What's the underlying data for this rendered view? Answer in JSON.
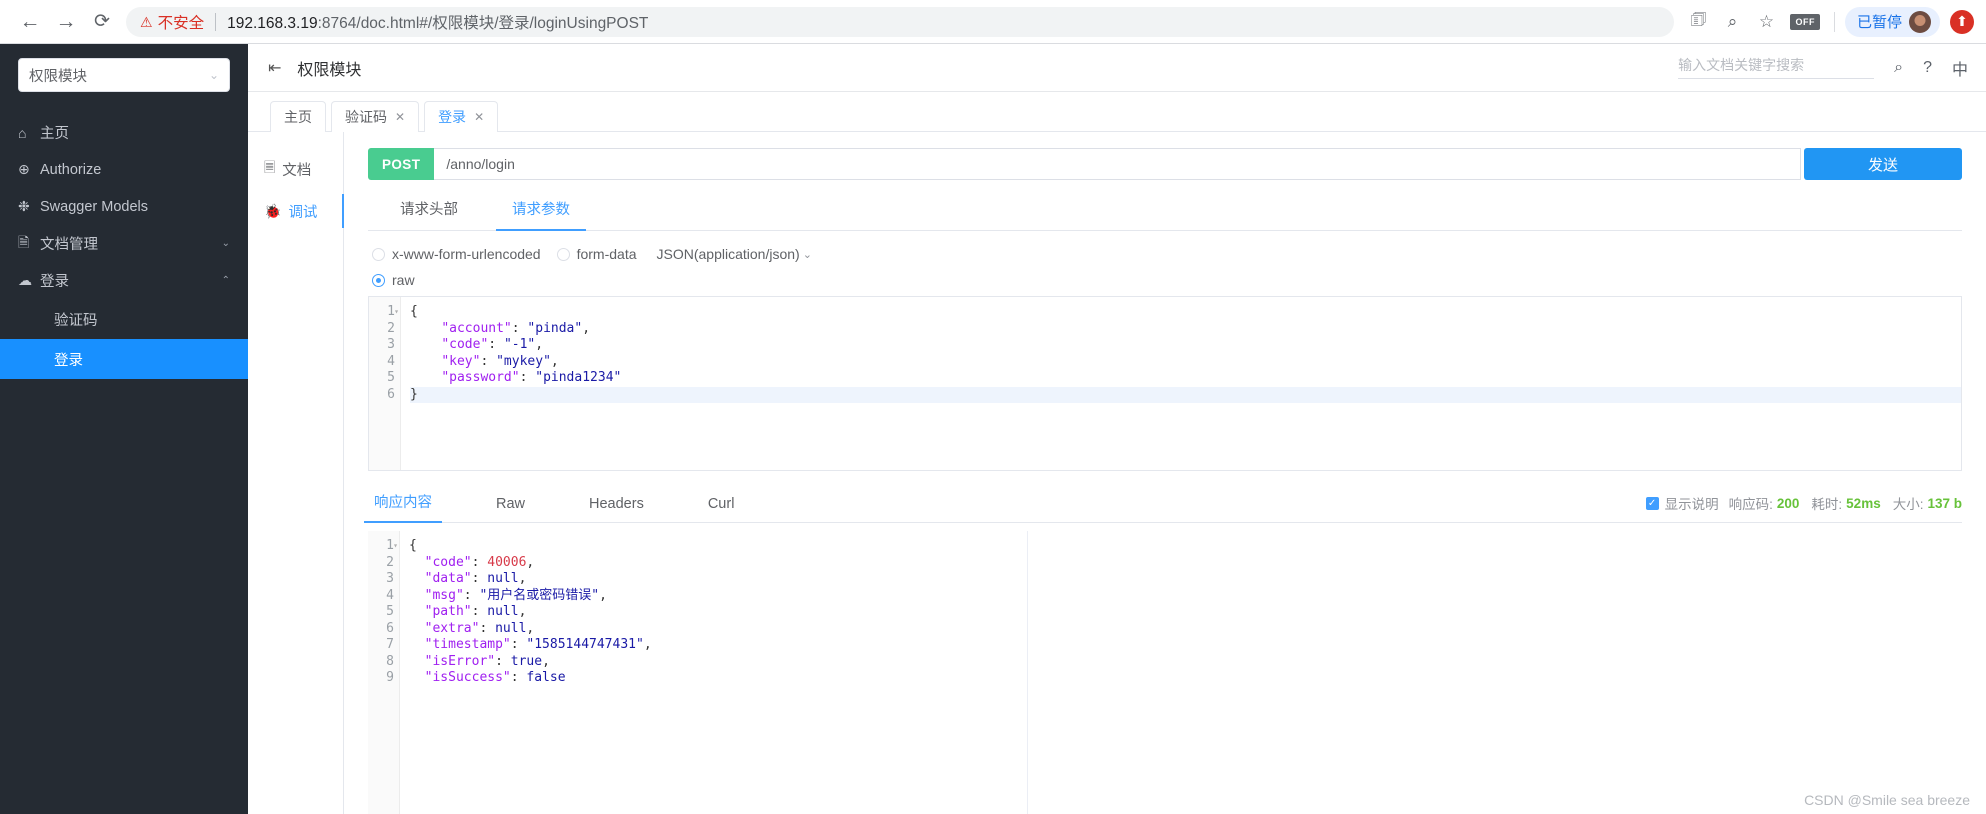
{
  "browser": {
    "back_icon": "arrow-left-icon",
    "forward_icon": "arrow-right-icon",
    "reload_icon": "reload-icon",
    "security_warning": "不安全",
    "url_host": "192.168.3.19",
    "url_path": ":8764/doc.html#/权限模块/登录/loginUsingPOST",
    "actions": {
      "translate_icon": "translate-icon",
      "zoom_icon": "zoom-out-icon",
      "bookmark_icon": "star-icon",
      "extension_off_label": "OFF",
      "profile_label": "已暂停",
      "avatar": "avatar",
      "update_icon": "update-icon"
    }
  },
  "sidebar": {
    "module_select_value": "权限模块",
    "items": [
      {
        "icon": "home-icon",
        "label": "主页",
        "arrow": ""
      },
      {
        "icon": "lock-icon",
        "label": "Authorize",
        "arrow": ""
      },
      {
        "icon": "swagger-icon",
        "label": "Swagger Models",
        "arrow": ""
      },
      {
        "icon": "doc-icon",
        "label": "文档管理",
        "arrow": "⌄"
      },
      {
        "icon": "cloud-icon",
        "label": "登录",
        "arrow": "⌃"
      }
    ],
    "sub_items": [
      {
        "label": "验证码",
        "active": false
      },
      {
        "label": "登录",
        "active": true
      }
    ]
  },
  "header": {
    "collapse_icon": "menu-collapse-icon",
    "title": "权限模块",
    "search_placeholder": "输入文档关键字搜索",
    "search_value": "",
    "search_icon": "search-icon",
    "help_icon": "help-icon",
    "lang_label": "中"
  },
  "tabs": [
    {
      "label": "主页",
      "closable": false,
      "active": false
    },
    {
      "label": "验证码",
      "closable": true,
      "active": false
    },
    {
      "label": "登录",
      "closable": true,
      "active": true
    }
  ],
  "vtabs": [
    {
      "icon": "document-icon",
      "label": "文档",
      "active": false
    },
    {
      "icon": "bug-icon",
      "label": "调试",
      "active": true
    }
  ],
  "request": {
    "method": "POST",
    "url": "/anno/login",
    "url_placeholder": "",
    "send_label": "发送",
    "tabs": [
      {
        "label": "请求头部",
        "active": false
      },
      {
        "label": "请求参数",
        "active": true
      }
    ],
    "content_types": [
      {
        "label": "x-www-form-urlencoded",
        "checked": false
      },
      {
        "label": "form-data",
        "checked": false
      },
      {
        "label": "raw",
        "checked": true
      }
    ],
    "json_type_label": "JSON(application/json)",
    "body_lines": [
      {
        "n": "1",
        "fold": "▾",
        "html": "{"
      },
      {
        "n": "2",
        "fold": "",
        "html": "    \"account\": \"pinda\","
      },
      {
        "n": "3",
        "fold": "",
        "html": "    \"code\": \"-1\","
      },
      {
        "n": "4",
        "fold": "",
        "html": "    \"key\": \"mykey\","
      },
      {
        "n": "5",
        "fold": "",
        "html": "    \"password\": \"pinda1234\""
      },
      {
        "n": "6",
        "fold": "",
        "html": "}"
      }
    ]
  },
  "response": {
    "tabs": [
      {
        "label": "响应内容",
        "active": true
      },
      {
        "label": "Raw",
        "active": false
      },
      {
        "label": "Headers",
        "active": false
      },
      {
        "label": "Curl",
        "active": false
      }
    ],
    "show_desc_label": "显示说明",
    "show_desc_checked": true,
    "status_code_label": "响应码:",
    "status_code_value": "200",
    "time_label": "耗时:",
    "time_value": "52ms",
    "size_label": "大小:",
    "size_value": "137 b",
    "body_lines": [
      {
        "n": "1",
        "fold": "▾",
        "html": "{"
      },
      {
        "n": "2",
        "fold": "",
        "html": "  \"code\": 40006,"
      },
      {
        "n": "3",
        "fold": "",
        "html": "  \"data\": null,"
      },
      {
        "n": "4",
        "fold": "",
        "html": "  \"msg\": \"用户名或密码错误\","
      },
      {
        "n": "5",
        "fold": "",
        "html": "  \"path\": null,"
      },
      {
        "n": "6",
        "fold": "",
        "html": "  \"extra\": null,"
      },
      {
        "n": "7",
        "fold": "",
        "html": "  \"timestamp\": \"1585144747431\","
      },
      {
        "n": "8",
        "fold": "",
        "html": "  \"isError\": true,"
      },
      {
        "n": "9",
        "fold": "",
        "html": "  \"isSuccess\": false"
      }
    ]
  },
  "watermark": "CSDN @Smile sea breeze",
  "colors": {
    "sidebar_bg": "#252b33",
    "accent": "#1890ff",
    "primary": "#409eff",
    "post_green": "#49cc90",
    "send_blue": "#2196f3",
    "success": "#67c23a",
    "danger": "#d93025"
  }
}
